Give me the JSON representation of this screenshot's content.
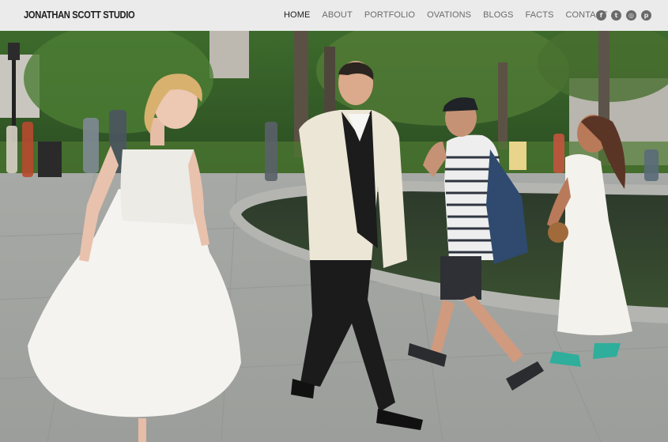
{
  "site": {
    "logo_text": "JONATHAN SCOTT STUDIO"
  },
  "nav": {
    "items": [
      {
        "label": "HOME",
        "active": true
      },
      {
        "label": "ABOUT",
        "active": false
      },
      {
        "label": "PORTFOLIO",
        "active": false
      },
      {
        "label": "OVATIONS",
        "active": false
      },
      {
        "label": "BLOGS",
        "active": false
      },
      {
        "label": "FACTS",
        "active": false
      },
      {
        "label": "CONTACT",
        "active": false
      }
    ]
  },
  "social": {
    "icons": [
      {
        "name": "facebook-icon",
        "glyph": "f"
      },
      {
        "name": "twitter-icon",
        "glyph": "t"
      },
      {
        "name": "instagram-icon",
        "glyph": "◎"
      },
      {
        "name": "pinterest-icon",
        "glyph": "p"
      }
    ]
  },
  "colors": {
    "header_bg": "#ebebeb",
    "nav_active": "#1a1a1a",
    "nav_text": "#6b6b6b",
    "icon_bg": "#6a6a6a"
  }
}
